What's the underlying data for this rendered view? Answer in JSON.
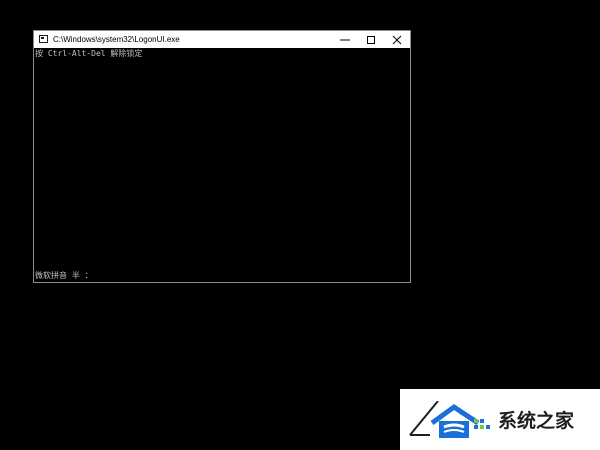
{
  "window": {
    "title": "C:\\Windows\\system32\\LogonUI.exe",
    "icon": "console-app-icon",
    "buttons": {
      "minimize": "minimize-icon",
      "maximize": "maximize-icon",
      "close": "close-icon"
    }
  },
  "console": {
    "lines": [
      "按 Ctrl-Alt-Del 解除锁定"
    ],
    "ime_status": "微软拼音 半 ："
  },
  "watermark": {
    "logo": "house-logo-icon",
    "text": "系统之家"
  },
  "colors": {
    "background": "#000000",
    "console_text": "#c0c0c0",
    "titlebar": "#ffffff",
    "window_border": "#8a8a8a",
    "logo_blue": "#1a6fd8",
    "logo_green": "#7dc242"
  }
}
